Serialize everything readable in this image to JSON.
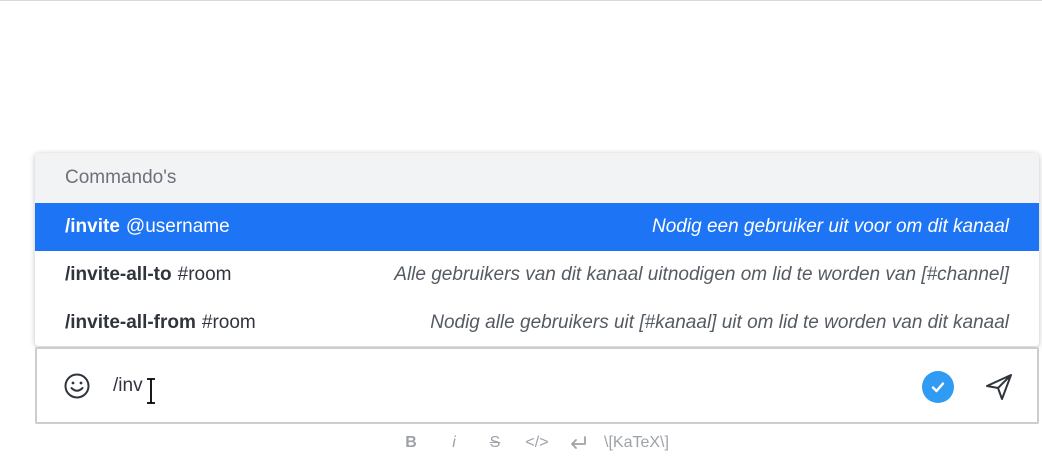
{
  "popup": {
    "header": "Commando's",
    "items": [
      {
        "command": "/invite",
        "param": "@username",
        "description": "Nodig een gebruiker uit voor om dit kanaal"
      },
      {
        "command": "/invite-all-to",
        "param": "#room",
        "description": "Alle gebruikers van dit kanaal uitnodigen om lid te worden van [#channel]"
      },
      {
        "command": "/invite-all-from",
        "param": "#room",
        "description": "Nodig alle gebruikers uit [#kanaal] uit om lid te worden van dit kanaal"
      }
    ],
    "active_index": 0
  },
  "composer": {
    "value": "/inv",
    "icons": {
      "emoji": "smiley-icon",
      "check": "check-circle-icon",
      "send": "send-icon"
    }
  },
  "toolbar": {
    "bold": "B",
    "italic": "i",
    "strike": "S",
    "code": "</>",
    "katex": "\\[KaTeX\\]",
    "icons": {
      "enter": "return-arrow-icon"
    }
  },
  "colors": {
    "accent": "#1d74f5",
    "check": "#2f9bf3",
    "muted": "#9ea2a8"
  }
}
